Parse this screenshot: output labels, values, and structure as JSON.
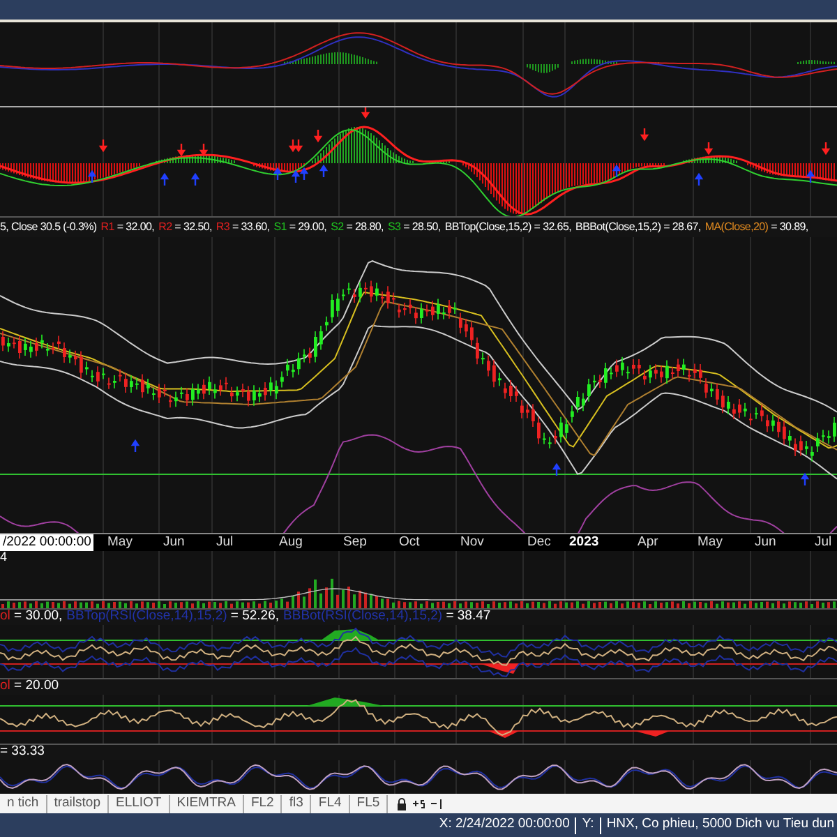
{
  "legend": [
    {
      "label": "5, Close 30.5 (-0.3%)",
      "color": "#ffffff"
    },
    {
      "label": "R1",
      "color": "#e02020",
      "value": "= 32.00,"
    },
    {
      "label": "R2",
      "color": "#e02020",
      "value": "= 32.50,"
    },
    {
      "label": "R3",
      "color": "#e02020",
      "value": "= 33.60,"
    },
    {
      "label": "S1",
      "color": "#20c020",
      "value": "= 29.00,"
    },
    {
      "label": "S2",
      "color": "#20c020",
      "value": "= 28.80,"
    },
    {
      "label": "S3",
      "color": "#20c020",
      "value": "= 28.50,"
    },
    {
      "label": "BBTop(Close,15,2)",
      "color": "#ffffff",
      "value": "= 32.65,"
    },
    {
      "label": "BBBot(Close,15,2)",
      "color": "#ffffff",
      "value": "= 28.67,"
    },
    {
      "label": "MA(Close,20)",
      "color": "#e08a20",
      "value": "= 30.89,"
    }
  ],
  "date_axis": {
    "cursor_date": "/2022 00:00:00",
    "labels": [
      {
        "text": "May",
        "bold": false
      },
      {
        "text": "Jun",
        "bold": false
      },
      {
        "text": "Jul",
        "bold": false
      },
      {
        "text": "Aug",
        "bold": false
      },
      {
        "text": "Sep",
        "bold": false
      },
      {
        "text": "Oct",
        "bold": false
      },
      {
        "text": "Nov",
        "bold": false
      },
      {
        "text": "Dec",
        "bold": false
      },
      {
        "text": "2023",
        "bold": true
      },
      {
        "text": "Apr",
        "bold": false
      },
      {
        "text": "May",
        "bold": false
      },
      {
        "text": "Jun",
        "bold": false
      },
      {
        "text": "Jul",
        "bold": false
      }
    ]
  },
  "volume_panel": {
    "label": "4"
  },
  "rsi_panel": {
    "legend": [
      {
        "label": "ol",
        "color": "#e02020",
        "value": "= 30.00,"
      },
      {
        "label": "BBTop(RSI(Close,14),15,2)",
        "color": "#2233aa",
        "value": "= 52.26,"
      },
      {
        "label": "BBBot(RSI(Close,14),15,2)",
        "color": "#2233aa",
        "value": "= 38.47"
      }
    ]
  },
  "oscillator_panel": {
    "legend": [
      {
        "label": "ol",
        "color": "#e02020",
        "value": "= 20.00"
      }
    ]
  },
  "third_panel": {
    "legend": [
      {
        "value": "= 33.33"
      }
    ]
  },
  "tabs": [
    {
      "label": "n tich",
      "selected": false
    },
    {
      "label": "trailstop",
      "selected": false
    },
    {
      "label": "ELLIOT",
      "selected": false
    },
    {
      "label": "KIEMTRA",
      "selected": false
    },
    {
      "label": "FL2",
      "selected": false
    },
    {
      "label": "fl3",
      "selected": false
    },
    {
      "label": "FL4",
      "selected": false
    },
    {
      "label": "FL5",
      "selected": false
    }
  ],
  "status_bar": [
    "X: 2/24/2022 00:00:00",
    "Y:",
    "HNX, Co phieu, 5000 Dich vu Tieu dun"
  ]
}
